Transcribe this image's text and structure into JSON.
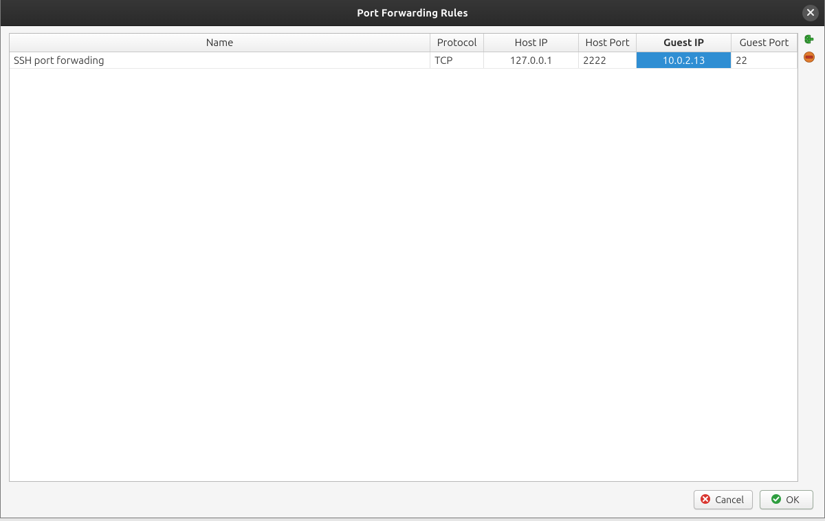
{
  "window": {
    "title": "Port Forwarding Rules"
  },
  "columns": {
    "name": "Name",
    "protocol": "Protocol",
    "host_ip": "Host IP",
    "host_port": "Host Port",
    "guest_ip": "Guest IP",
    "guest_port": "Guest Port",
    "sorted_column": "guest_ip"
  },
  "rules": [
    {
      "name": "SSH port forwading",
      "protocol": "TCP",
      "host_ip": "127.0.0.1",
      "host_port": "2222",
      "guest_ip": "10.0.2.13",
      "guest_port": "22",
      "selected_field": "guest_ip"
    }
  ],
  "toolbar": {
    "add_tooltip": "Add rule",
    "remove_tooltip": "Remove rule"
  },
  "footer": {
    "cancel_label": "Cancel",
    "ok_label": "OK"
  }
}
